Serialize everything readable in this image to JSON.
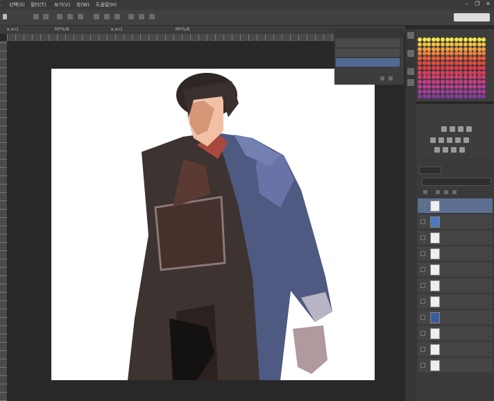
{
  "menubar": {
    "items": [
      "선택(S)",
      "필터(T)",
      "보기(V)",
      "창(W)",
      "도움말(H)"
    ]
  },
  "window_controls": [
    "–",
    "❐",
    "✕"
  ],
  "workspace": {
    "label": ""
  },
  "tabs": [
    {
      "label": "e.en1",
      "mode": "MY%/8"
    },
    {
      "label": "e.en1",
      "mode": "MY%/8"
    }
  ],
  "history": {
    "tab_label": "",
    "items": [
      "",
      "",
      ""
    ],
    "selected_index": 2
  },
  "swatches": {
    "tab_label": "",
    "colors": [
      "#f2e84a",
      "#f5c23a",
      "#f5a03a",
      "#f27f3a",
      "#f05a3a",
      "#e9473a",
      "#e63a4a",
      "#e23a5e",
      "#d83a72",
      "#cc3a86",
      "#bf3a96",
      "#a83aa0",
      "#8a3aa0"
    ]
  },
  "adjustments": {
    "tab_label": "",
    "label": ""
  },
  "layers": {
    "tab_labels": [
      "",
      ""
    ],
    "items": [
      {
        "name": ""
      },
      {
        "name": ""
      },
      {
        "name": ""
      },
      {
        "name": ""
      },
      {
        "name": ""
      },
      {
        "name": ""
      },
      {
        "name": ""
      },
      {
        "name": ""
      },
      {
        "name": ""
      },
      {
        "name": ""
      },
      {
        "name": ""
      }
    ],
    "selected_index": 0
  }
}
